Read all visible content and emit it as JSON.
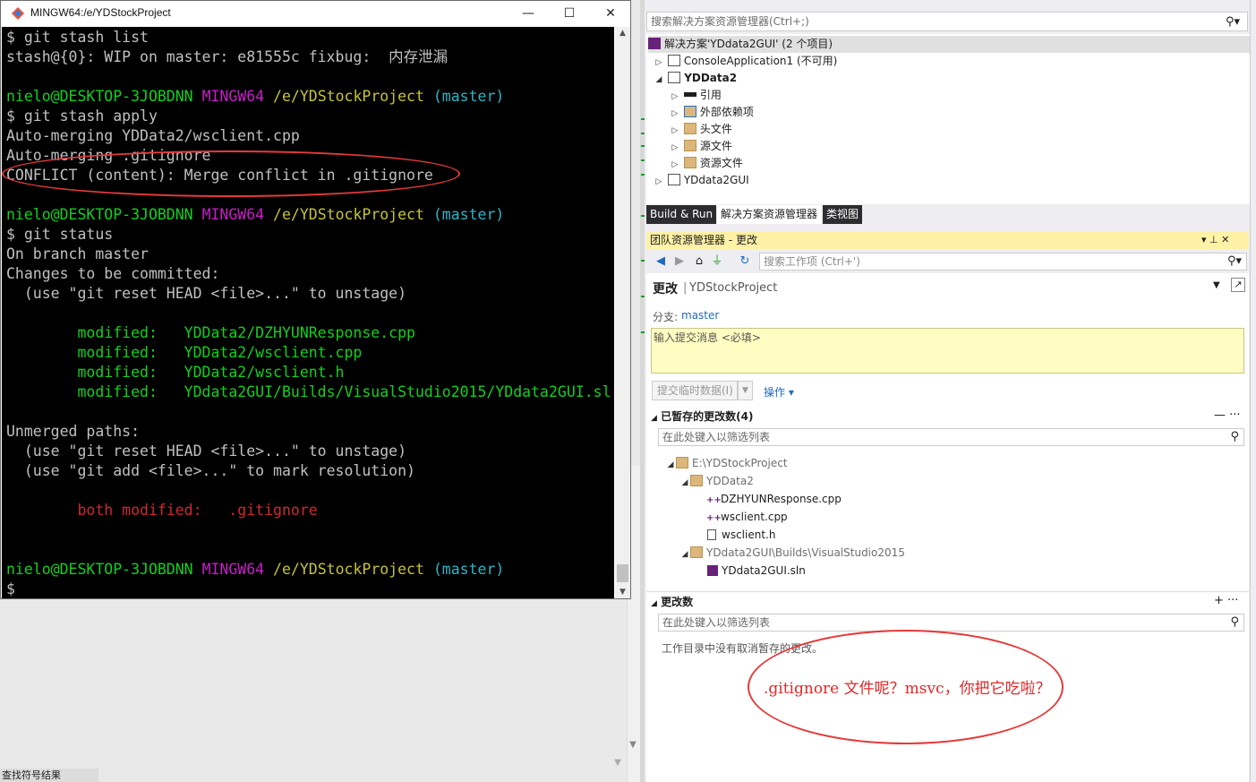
{
  "terminal": {
    "title": "MINGW64:/e/YDStockProject",
    "min_glyph": "—",
    "max_glyph": "☐",
    "close_glyph": "✕",
    "lines": {
      "l1": "$ git stash list",
      "l2": "stash@{0}: WIP on master: e81555c fixbug:  内存泄漏",
      "p1_user": "nielo@DESKTOP-3JOBDNN",
      "p_mingw": "MINGW64",
      "p_path": "/e/YDStockProject",
      "p_branch": "(master)",
      "l4": "$ git stash apply",
      "l5": "Auto-merging YDData2/wsclient.cpp",
      "l6": "Auto-merging .gitignore",
      "l7": "CONFLICT (content): Merge conflict in .gitignore",
      "l9": "$ git status",
      "l10": "On branch master",
      "l11": "Changes to be committed:",
      "l12": "  (use \"git reset HEAD <file>...\" to unstage)",
      "m1": "        modified:   YDData2/DZHYUNResponse.cpp",
      "m2": "        modified:   YDData2/wsclient.cpp",
      "m3": "        modified:   YDData2/wsclient.h",
      "m4": "        modified:   YDdata2GUI/Builds/VisualStudio2015/YDdata2GUI.sl",
      "l17": "Unmerged paths:",
      "l18": "  (use \"git reset HEAD <file>...\" to unstage)",
      "l19": "  (use \"git add <file>...\" to mark resolution)",
      "both": "        both modified:   .gitignore",
      "prompt_last": "$"
    }
  },
  "bottom_strip": "查找符号结果",
  "solution_explorer": {
    "search_placeholder": "搜索解决方案资源管理器(Ctrl+;)",
    "items": [
      {
        "label": "解决方案'YDdata2GUI' (2 个项目)"
      },
      {
        "label": "ConsoleApplication1 (不可用)"
      },
      {
        "label": "YDData2"
      },
      {
        "label": "引用"
      },
      {
        "label": "外部依赖项"
      },
      {
        "label": "头文件"
      },
      {
        "label": "源文件"
      },
      {
        "label": "资源文件"
      },
      {
        "label": "YDdata2GUI"
      }
    ]
  },
  "tabs": [
    "Build & Run",
    "解决方案资源管理器",
    "类视图"
  ],
  "team_explorer": {
    "header": "团队资源管理器 - 更改",
    "pin": "▾ ⊥ ✕",
    "search_placeholder": "搜索工作项 (Ctrl+')",
    "changes_title": "更改",
    "separator": "|",
    "project": "YDStockProject",
    "branch_label": "分支:",
    "branch_value": "master",
    "commit_placeholder": "输入提交消息 <必填>",
    "commit_button": "提交临时数据(I)",
    "actions": "操作 ▾",
    "staged_header": "已暂存的更改数(4)",
    "filter_placeholder": "在此处键入以筛选列表",
    "staged_tree": [
      "E:\\YDStockProject",
      "YDData2",
      "DZHYUNResponse.cpp",
      "wsclient.cpp",
      "wsclient.h",
      "YDdata2GUI\\Builds\\VisualStudio2015",
      "YDdata2GUI.sln"
    ],
    "changes_header": "更改数",
    "no_changes": "工作目录中没有取消暂存的更改。"
  },
  "annotation": ".gitignore 文件呢？msvc，你把它吃啦？",
  "colors": {
    "terminal_bg": "#000000",
    "green": "#11d11f",
    "magenta": "#c81ec8",
    "yellow": "#c6c43a",
    "cyan": "#2cb6c6",
    "red": "#d0282f",
    "annotation_red": "#e53a3a"
  }
}
